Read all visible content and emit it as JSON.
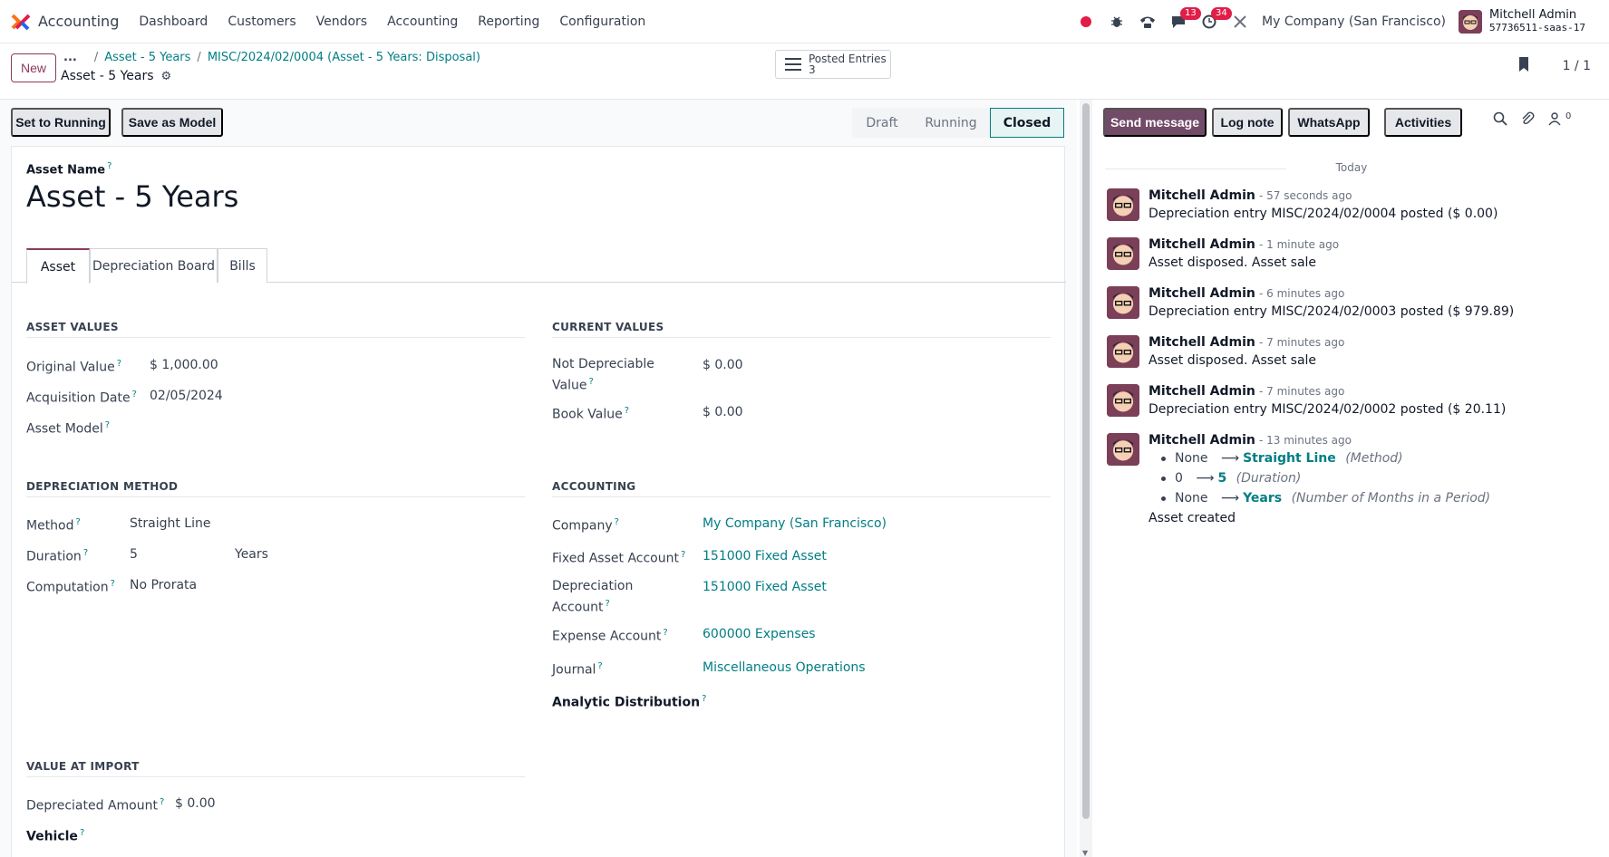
{
  "navbar": {
    "app_title": "Accounting",
    "menu": [
      "Dashboard",
      "Customers",
      "Vendors",
      "Accounting",
      "Reporting",
      "Configuration"
    ],
    "messages_badge": "13",
    "activities_badge": "34",
    "company": "My Company (San Francisco)",
    "user_name": "Mitchell Admin",
    "user_db": "57736511-saas-17"
  },
  "control": {
    "new_label": "New",
    "breadcrumb_dots": "...",
    "breadcrumbs": [
      "Asset - 5 Years",
      "MISC/2024/02/0004 (Asset - 5 Years: Disposal)"
    ],
    "record_title": "Asset - 5 Years",
    "posted_entries_label": "Posted Entries",
    "posted_entries_count": "3",
    "pager": "1 / 1"
  },
  "status_bar": {
    "set_running": "Set to Running",
    "save_model": "Save as Model",
    "stages": [
      "Draft",
      "Running",
      "Closed"
    ],
    "active_stage": "Closed"
  },
  "form": {
    "asset_name_label": "Asset Name",
    "asset_name": "Asset - 5 Years",
    "tabs": [
      "Asset",
      "Depreciation Board",
      "Bills"
    ],
    "asset_values": {
      "title": "ASSET VALUES",
      "original_value_label": "Original Value",
      "original_value": "$ 1,000.00",
      "acquisition_date_label": "Acquisition Date",
      "acquisition_date": "02/05/2024",
      "asset_model_label": "Asset Model"
    },
    "current_values": {
      "title": "CURRENT VALUES",
      "not_depreciable_label_1": "Not Depreciable",
      "not_depreciable_label_2": "Value",
      "not_depreciable": "$ 0.00",
      "book_value_label": "Book Value",
      "book_value": "$ 0.00"
    },
    "depreciation_method": {
      "title": "DEPRECIATION METHOD",
      "method_label": "Method",
      "method": "Straight Line",
      "duration_label": "Duration",
      "duration": "5",
      "duration_unit": "Years",
      "computation_label": "Computation",
      "computation": "No Prorata"
    },
    "accounting": {
      "title": "ACCOUNTING",
      "company_label": "Company",
      "company": "My Company (San Francisco)",
      "fixed_account_label": "Fixed Asset Account",
      "fixed_account": "151000 Fixed Asset",
      "depreciation_account_label_1": "Depreciation",
      "depreciation_account_label_2": "Account",
      "depreciation_account": "151000 Fixed Asset",
      "expense_account_label": "Expense Account",
      "expense_account": "600000 Expenses",
      "journal_label": "Journal",
      "journal": "Miscellaneous Operations",
      "analytic_label": "Analytic Distribution"
    },
    "value_at_import": {
      "title": "VALUE AT IMPORT",
      "depreciated_amount_label": "Depreciated Amount",
      "depreciated_amount": "$ 0.00",
      "vehicle_label": "Vehicle"
    },
    "help_mark": "?"
  },
  "chatter": {
    "send_message": "Send message",
    "log_note": "Log note",
    "whatsapp": "WhatsApp",
    "activities": "Activities",
    "followers_count": "0",
    "today": "Today",
    "messages": [
      {
        "author": "Mitchell Admin",
        "when": "- 57 seconds ago",
        "body": "Depreciation entry MISC/2024/02/0004 posted ($ 0.00)"
      },
      {
        "author": "Mitchell Admin",
        "when": "- 1 minute ago",
        "body": "Asset disposed. Asset sale"
      },
      {
        "author": "Mitchell Admin",
        "when": "- 6 minutes ago",
        "body": "Depreciation entry MISC/2024/02/0003 posted ($ 979.89)"
      },
      {
        "author": "Mitchell Admin",
        "when": "- 7 minutes ago",
        "body": "Asset disposed. Asset sale"
      },
      {
        "author": "Mitchell Admin",
        "when": "- 7 minutes ago",
        "body": "Depreciation entry MISC/2024/02/0002 posted ($ 20.11)"
      },
      {
        "author": "Mitchell Admin",
        "when": "- 13 minutes ago",
        "body": "Asset created"
      }
    ],
    "tracking": [
      {
        "old": "None",
        "new": "Straight Line",
        "field": "(Method)"
      },
      {
        "old": "0",
        "new": "5",
        "field": "(Duration)"
      },
      {
        "old": "None",
        "new": "Years",
        "field": "(Number of Months in a Period)"
      }
    ],
    "arrow": "⟶"
  },
  "colors": {
    "brand": "#714b67",
    "link": "#017e84"
  }
}
